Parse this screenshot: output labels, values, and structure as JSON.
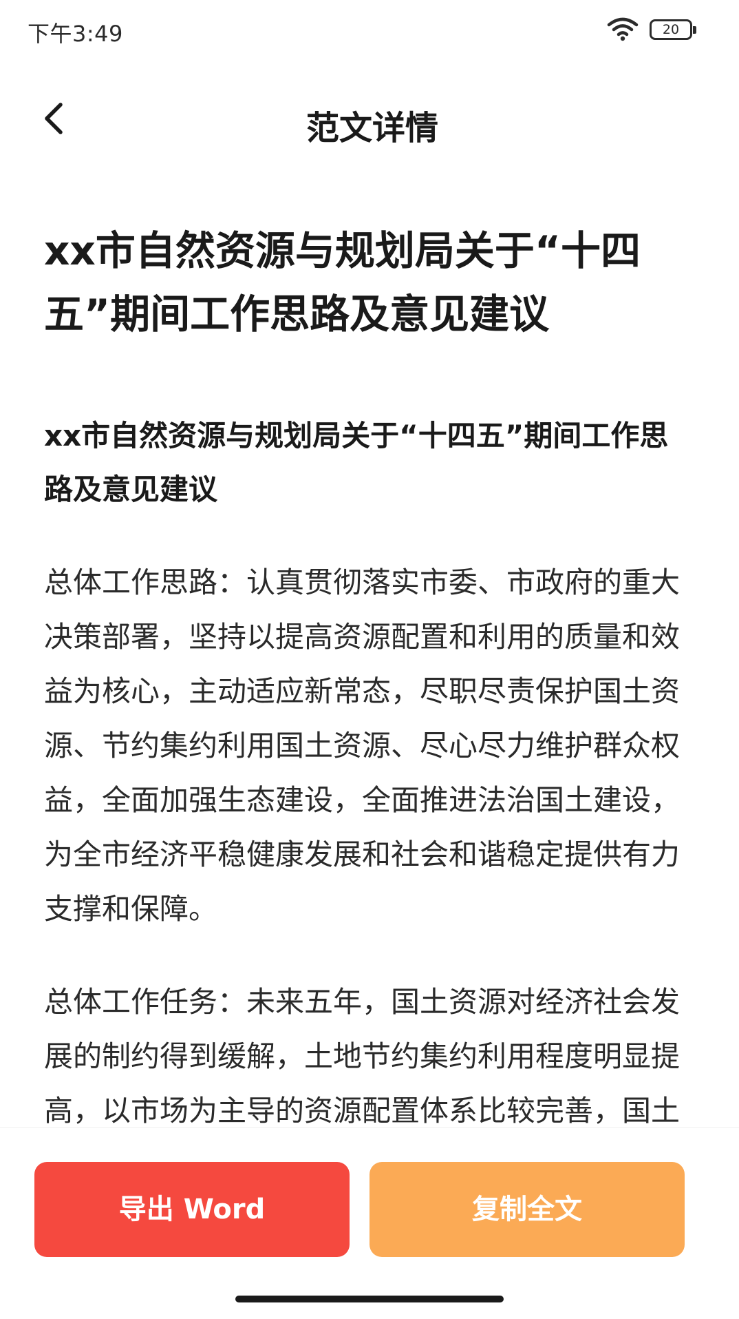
{
  "status_bar": {
    "time": "下午3:49",
    "battery_level": "20",
    "icons": [
      "wifi-icon",
      "battery-icon"
    ]
  },
  "nav": {
    "title": "范文详情",
    "back_icon": "chevron-left-icon"
  },
  "article": {
    "title": "xx市自然资源与规划局关于“十四五”期间工作思路及意见建议",
    "subtitle": "xx市自然资源与规划局关于“十四五”期间工作思路及意见建议",
    "paragraphs": [
      "总体工作思路：认真贯彻落实市委、市政府的重大决策部署，坚持以提高资源配置和利用的质量和效益为核心，主动适应新常态，尽职尽责保护国土资源、节约集约利用国土资源、尽心尽力维护群众权益，全面加强生态建设，全面推进法治国土建设，为全市经济平稳健康发展和社会和谐稳定提供有力支撑和保障。",
      "总体工作任务：未来五年，国土资源对经济社会发展的制约得到缓解，土地节约集约利用程度明显提高，以市场为主导的资源配置体系比较完善，国土资源管理参与宏观调控"
    ]
  },
  "actions": {
    "export_label": "导出 Word",
    "copy_label": "复制全文",
    "colors": {
      "export": "#f5493f",
      "copy": "#fbaa55"
    }
  }
}
